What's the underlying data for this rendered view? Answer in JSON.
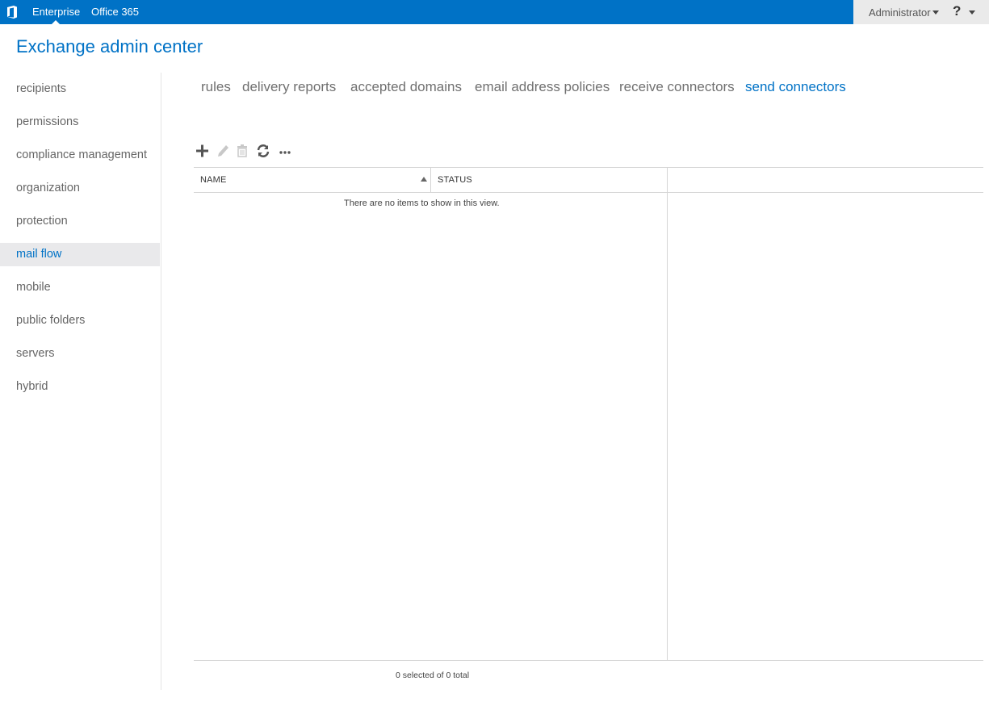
{
  "topbar": {
    "logo_icon": "office-logo-icon",
    "nav": [
      "Enterprise",
      "Office 365"
    ],
    "active_nav": "Enterprise",
    "user": "Administrator",
    "help_label": "?"
  },
  "app_title": "Exchange admin center",
  "sidebar": {
    "items": [
      {
        "label": "recipients"
      },
      {
        "label": "permissions"
      },
      {
        "label": "compliance management"
      },
      {
        "label": "organization"
      },
      {
        "label": "protection"
      },
      {
        "label": "mail flow",
        "active": true
      },
      {
        "label": "mobile"
      },
      {
        "label": "public folders"
      },
      {
        "label": "servers"
      },
      {
        "label": "hybrid"
      }
    ]
  },
  "tabs": [
    {
      "label": "rules"
    },
    {
      "label": "delivery reports"
    },
    {
      "label": "accepted domains"
    },
    {
      "label": "email address policies"
    },
    {
      "label": "receive connectors"
    },
    {
      "label": "send connectors",
      "active": true
    }
  ],
  "toolbar": {
    "buttons": [
      {
        "icon": "add-icon",
        "enabled": true
      },
      {
        "icon": "edit-icon",
        "enabled": false
      },
      {
        "icon": "delete-icon",
        "enabled": false
      },
      {
        "icon": "refresh-icon",
        "enabled": true
      },
      {
        "icon": "more-icon",
        "enabled": true
      }
    ]
  },
  "grid": {
    "columns": [
      "NAME",
      "STATUS"
    ],
    "sort_column": "NAME",
    "sort_direction": "ascending",
    "rows": [],
    "empty_message": "There are no items to show in this view."
  },
  "footer": {
    "selection_status": "0 selected of 0 total"
  },
  "colors": {
    "accent": "#0072c6",
    "topbar_bg": "#0072c6",
    "active_sidebar_bg": "#e9e9eb"
  }
}
